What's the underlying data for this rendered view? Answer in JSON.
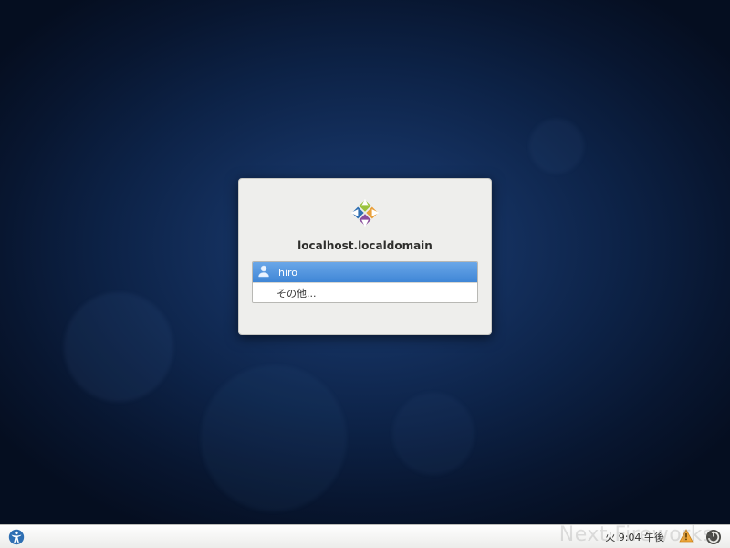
{
  "login": {
    "hostname": "localhost.localdomain",
    "users": [
      {
        "name": "hiro",
        "selected": true
      }
    ],
    "other_label": "その他..."
  },
  "taskbar": {
    "clock": "火  9:04 午後"
  },
  "watermark": "Next Fireworks",
  "icons": {
    "accessibility": "accessibility-icon",
    "battery_warn": "battery-warning-icon",
    "power": "power-icon",
    "user": "user-icon",
    "logo": "centos-logo"
  }
}
